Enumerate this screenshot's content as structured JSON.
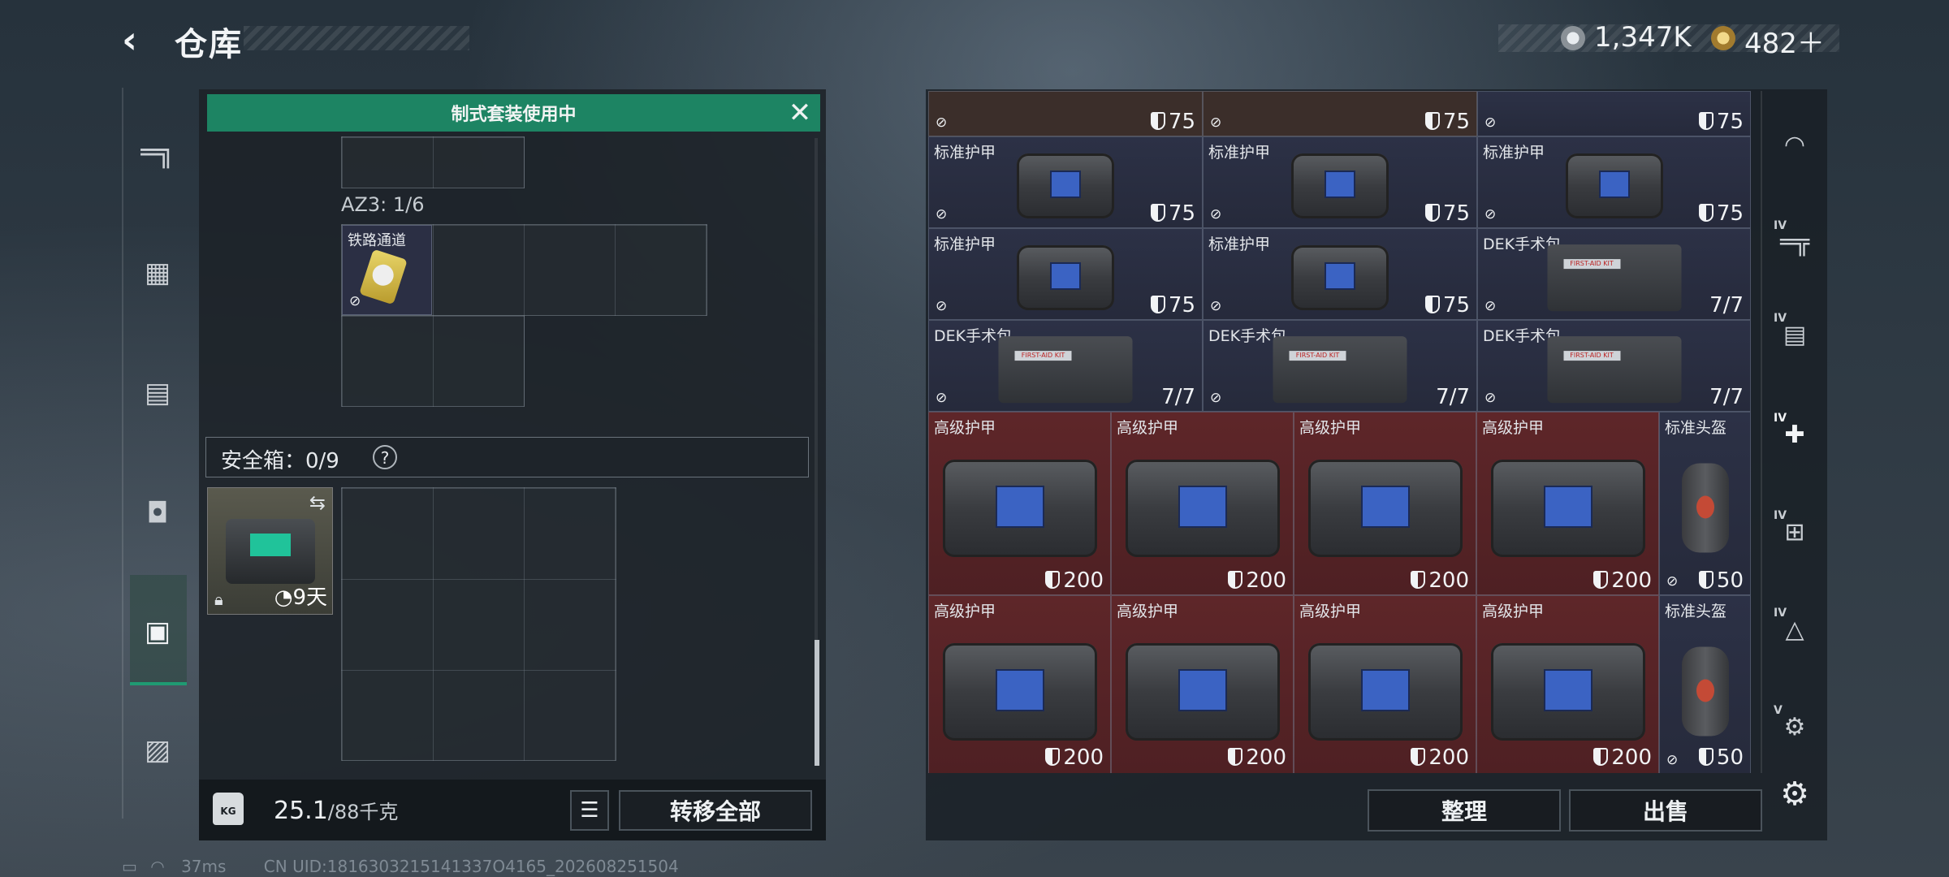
{
  "header": {
    "back_icon": "back-arrow-icon",
    "title": "仓库",
    "currency1_icon": "silver-coin-icon",
    "currency1": "1,347K",
    "currency2_icon": "gold-coin-icon",
    "currency2": "482＋"
  },
  "left_nav": {
    "items": [
      {
        "name": "gun-icon",
        "glyph": "🔫"
      },
      {
        "name": "vest-icon",
        "glyph": "🦺"
      },
      {
        "name": "backpack-icon",
        "glyph": "🎒"
      },
      {
        "name": "bag-icon",
        "glyph": "👜"
      },
      {
        "name": "container-icon",
        "glyph": "🗄"
      },
      {
        "name": "briefcase-icon",
        "glyph": "💼"
      }
    ],
    "active_index": 4
  },
  "loadout": {
    "banner": "制式套装使用中",
    "az3_label": "AZ3: 1/6",
    "item_name": "铁路通道",
    "safebox_label": "安全箱：0/9",
    "safebox_help": "?",
    "safebox_timer": "9天",
    "weight_value": "25.1",
    "weight_max": "/88千克",
    "transfer_all": "转移全部",
    "weight_icon_text": "KG"
  },
  "storage": {
    "row0": [
      {
        "val": "75"
      },
      {
        "val": "75"
      },
      {
        "val": "75"
      }
    ],
    "row1": [
      {
        "name": "标准护甲",
        "val": "75"
      },
      {
        "name": "标准护甲",
        "val": "75"
      },
      {
        "name": "标准护甲",
        "val": "75"
      }
    ],
    "row2": [
      {
        "name": "标准护甲",
        "val": "75"
      },
      {
        "name": "标准护甲",
        "val": "75"
      },
      {
        "name": "DEK手术包",
        "val": "7/7"
      }
    ],
    "row3": [
      {
        "name": "DEK手术包",
        "val": "7/7"
      },
      {
        "name": "DEK手术包",
        "val": "7/7"
      },
      {
        "name": "DEK手术包",
        "val": "7/7"
      }
    ],
    "row4": [
      {
        "name": "高级护甲",
        "val": "200"
      },
      {
        "name": "高级护甲",
        "val": "200"
      },
      {
        "name": "高级护甲",
        "val": "200"
      },
      {
        "name": "高级护甲",
        "val": "200"
      },
      {
        "name": "标准头盔",
        "val": "50"
      }
    ],
    "row5": [
      {
        "name": "高级护甲",
        "val": "200"
      },
      {
        "name": "高级护甲",
        "val": "200"
      },
      {
        "name": "高级护甲",
        "val": "200"
      },
      {
        "name": "高级护甲",
        "val": "200"
      },
      {
        "name": "标准头盔",
        "val": "50"
      }
    ],
    "kit_strip": "FIRST-AID KIT"
  },
  "actions": {
    "sort": "整理",
    "sell": "出售"
  },
  "right_nav": {
    "items": [
      {
        "name": "helmet-icon",
        "tier": ""
      },
      {
        "name": "rifle-icon",
        "tier": "IV"
      },
      {
        "name": "ammo-box-icon",
        "tier": "IV"
      },
      {
        "name": "medkit-icon",
        "tier": "IV"
      },
      {
        "name": "medkit-plus-icon",
        "tier": "IV"
      },
      {
        "name": "crate-icon",
        "tier": "IV"
      },
      {
        "name": "attachment-icon",
        "tier": "V"
      }
    ],
    "settings_icon": "gear-icon"
  },
  "status": {
    "ping": "37ms",
    "uid": "CN UID:1816303215141337O4165_202608251504"
  }
}
